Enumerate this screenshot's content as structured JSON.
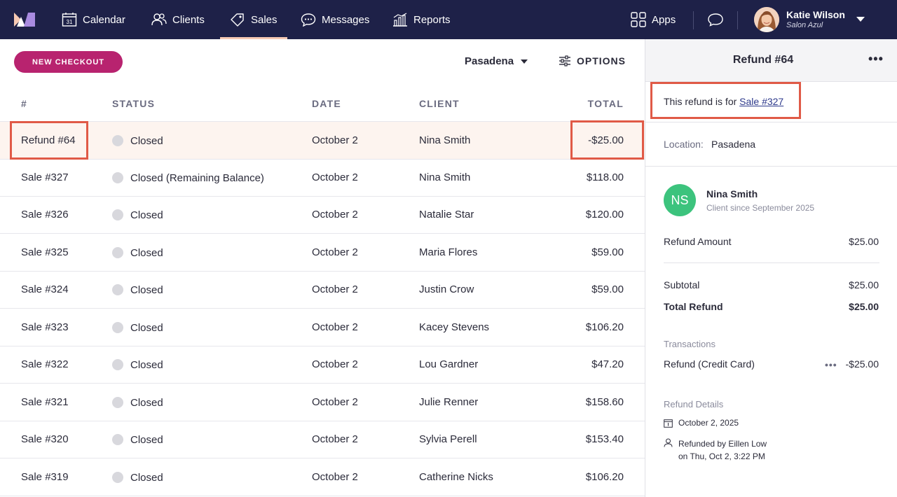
{
  "nav": {
    "items": [
      {
        "label": "Calendar",
        "icon": "calendar-icon"
      },
      {
        "label": "Clients",
        "icon": "clients-icon"
      },
      {
        "label": "Sales",
        "icon": "tag-icon",
        "active": true
      },
      {
        "label": "Messages",
        "icon": "chat-icon"
      },
      {
        "label": "Reports",
        "icon": "bar-chart-icon"
      }
    ],
    "apps_label": "Apps",
    "calendar_day": "31",
    "user": {
      "name": "Katie Wilson",
      "business": "Salon Azul"
    }
  },
  "toolbar": {
    "new_checkout_label": "NEW CHECKOUT",
    "location": "Pasadena",
    "options_label": "OPTIONS"
  },
  "table": {
    "headers": {
      "id": "#",
      "status": "STATUS",
      "date": "DATE",
      "client": "CLIENT",
      "total": "TOTAL"
    },
    "rows": [
      {
        "id": "Refund #64",
        "status": "Closed",
        "date": "October 2",
        "client": "Nina Smith",
        "total": "-$25.00",
        "highlight": true
      },
      {
        "id": "Sale #327",
        "status": "Closed (Remaining Balance)",
        "date": "October 2",
        "client": "Nina Smith",
        "total": "$118.00"
      },
      {
        "id": "Sale #326",
        "status": "Closed",
        "date": "October 2",
        "client": "Natalie Star",
        "total": "$120.00"
      },
      {
        "id": "Sale #325",
        "status": "Closed",
        "date": "October 2",
        "client": "Maria Flores",
        "total": "$59.00"
      },
      {
        "id": "Sale #324",
        "status": "Closed",
        "date": "October 2",
        "client": "Justin Crow",
        "total": "$59.00"
      },
      {
        "id": "Sale #323",
        "status": "Closed",
        "date": "October 2",
        "client": "Kacey Stevens",
        "total": "$106.20"
      },
      {
        "id": "Sale #322",
        "status": "Closed",
        "date": "October 2",
        "client": "Lou Gardner",
        "total": "$47.20"
      },
      {
        "id": "Sale #321",
        "status": "Closed",
        "date": "October 2",
        "client": "Julie Renner",
        "total": "$158.60"
      },
      {
        "id": "Sale #320",
        "status": "Closed",
        "date": "October 2",
        "client": "Sylvia Perell",
        "total": "$153.40"
      },
      {
        "id": "Sale #319",
        "status": "Closed",
        "date": "October 2",
        "client": "Catherine Nicks",
        "total": "$106.20"
      }
    ]
  },
  "panel": {
    "title": "Refund #64",
    "more_label": "•••",
    "refund_for_prefix": "This refund is for ",
    "refund_for_link": "Sale #327",
    "location_label": "Location:",
    "location_value": "Pasadena",
    "client": {
      "initials": "NS",
      "name": "Nina Smith",
      "since": "Client since September 2025"
    },
    "refund_amount_label": "Refund Amount",
    "refund_amount_value": "$25.00",
    "subtotal_label": "Subtotal",
    "subtotal_value": "$25.00",
    "total_refund_label": "Total Refund",
    "total_refund_value": "$25.00",
    "transactions_label": "Transactions",
    "transaction": {
      "label": "Refund (Credit Card)",
      "more": "•••",
      "value": "-$25.00"
    },
    "details_label": "Refund Details",
    "detail_date": "October 2, 2025",
    "detail_by_line1": "Refunded by Eillen Low",
    "detail_by_line2": "on Thu, Oct 2, 3:22 PM"
  },
  "colors": {
    "nav_bg": "#1e2148",
    "accent": "#b8236f",
    "highlight_row": "#fdf4ef",
    "annotation_box": "#e05a47",
    "client_avatar": "#3cc37d"
  }
}
